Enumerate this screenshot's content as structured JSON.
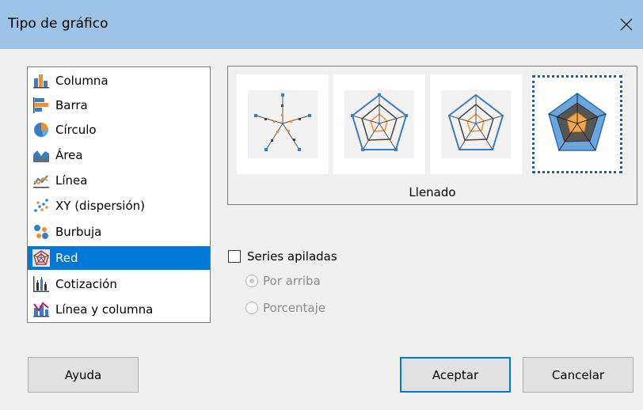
{
  "dialog": {
    "title": "Tipo de gráfico",
    "close_icon": "close-icon"
  },
  "chart_types": [
    {
      "label": "Columna",
      "icon": "column-chart-icon"
    },
    {
      "label": "Barra",
      "icon": "bar-chart-icon"
    },
    {
      "label": "Círculo",
      "icon": "pie-chart-icon"
    },
    {
      "label": "Área",
      "icon": "area-chart-icon"
    },
    {
      "label": "Línea",
      "icon": "line-chart-icon"
    },
    {
      "label": "XY (dispersión)",
      "icon": "scatter-chart-icon"
    },
    {
      "label": "Burbuja",
      "icon": "bubble-chart-icon"
    },
    {
      "label": "Red",
      "icon": "net-chart-icon",
      "selected": true
    },
    {
      "label": "Cotización",
      "icon": "stock-chart-icon"
    },
    {
      "label": "Línea y columna",
      "icon": "column-line-chart-icon"
    }
  ],
  "variants": {
    "selected_label": "Llenado",
    "items": [
      {
        "icon": "net-points-icon"
      },
      {
        "icon": "net-lines-points-icon"
      },
      {
        "icon": "net-lines-icon"
      },
      {
        "icon": "net-filled-icon",
        "selected": true
      }
    ]
  },
  "options": {
    "stacked_label": "Series apiladas",
    "stacked_checked": false,
    "on_top_label": "Por arriba",
    "percent_label": "Porcentaje"
  },
  "buttons": {
    "help": "Ayuda",
    "ok": "Aceptar",
    "cancel": "Cancelar"
  },
  "colors": {
    "selection": "#0078d7",
    "titlebar": "#9dc3e6",
    "blue_series": "#3a7ebf",
    "orange_series": "#f0902a"
  }
}
